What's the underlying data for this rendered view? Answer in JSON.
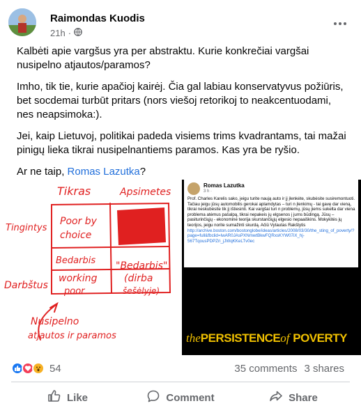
{
  "post": {
    "author": "Raimondas Kuodis",
    "timestamp": "21h",
    "separator": "·",
    "privacy_icon": "globe-icon",
    "paragraphs": [
      "Kalbėti apie vargšus yra per abstraktu. Kurie konkrečiai vargšai nusipelno atjautos/paramos?",
      "Imho, tik tie, kurie apačioj kairėj. Čia gal labiau konservatyvus požiūris, bet socdemai turbūt pritars (nors viešoj retorikoj to neakcentuodami, nes neapsimoka:).",
      "Jei, kaip Lietuvoj, politikai padeda visiems trims kvadrantams, tai mažai pinigų lieka tikrai nusipelnantiems paramos. Kas yra be ryšio."
    ],
    "last_paragraph_prefix": "Ar ne taip, ",
    "mention": "Romas Lazutka",
    "last_paragraph_suffix": "?"
  },
  "sketch": {
    "col_left": "Tikras",
    "col_right": "Apsimetes",
    "row_top": "Tingintys",
    "row_bottom": "Darbštus",
    "cell_tl_1": "Poor by",
    "cell_tl_2": "choice",
    "cell_ml": "Bedarbis",
    "cell_mr_1": "\"Bedarbis\"",
    "cell_mr_2": "(dirba",
    "cell_mr_3": "šešėlyje)",
    "cell_bl_1": "working",
    "cell_bl_2": "poor",
    "note_1": "Nusipelno",
    "note_2": "atjautos ir paramos",
    "ink_color": "#e02020"
  },
  "shared_post": {
    "author": "Romas Lazutka",
    "meta": "3 h · ",
    "body": "Prof. Charles Karelis sako, jeigu turite naują auto ir jį įlenkėte, skubėsite susiremontuoti. Tačiau jeigu jūsų automobilis gerokai aplamdytas – turi n įlenkimų - tai gavę dar vieną, tikrai neskubėsite tik jį ištiesinti. Kai vargšai turi n problemų, jūsų jiems sukelta dar viena problema atėmus pašalpą, tikrai nepakeis jų elgsenos į jums būdingą. Jūsų – pasiturinčiųjų - ekonominė teorija skurstančiųjų elgesio nepaaiškins. Mokykitės jų teorijos, jeigu norite sumažinti skurdą. Ačiū Vytautas Rakštytis ",
    "url": "http://archive.boston.com/bostonglobe/ideas/articles/2008/03/30/the_sting_of_poverty/?page=full&fbclid=IwAR0JAsPXNmwtBkwFQRxsKYW07iX_hj-567TqousPDPZri_jJWqKKeLTv0ec",
    "banner_the": "the",
    "banner_persistence": "PERSISTENCE",
    "banner_of": "of",
    "banner_poverty": "POVERTY"
  },
  "stats": {
    "reaction_icons": [
      "like-icon",
      "love-icon",
      "wow-icon"
    ],
    "reaction_count": "54",
    "comments": "35 comments",
    "shares": "3 shares"
  },
  "actions": {
    "like": "Like",
    "comment": "Comment",
    "share": "Share"
  },
  "colors": {
    "link": "#216fdb",
    "like": "#1877f2",
    "love": "#f33e58",
    "wow": "#f7b125",
    "banner": "#f0c000"
  }
}
